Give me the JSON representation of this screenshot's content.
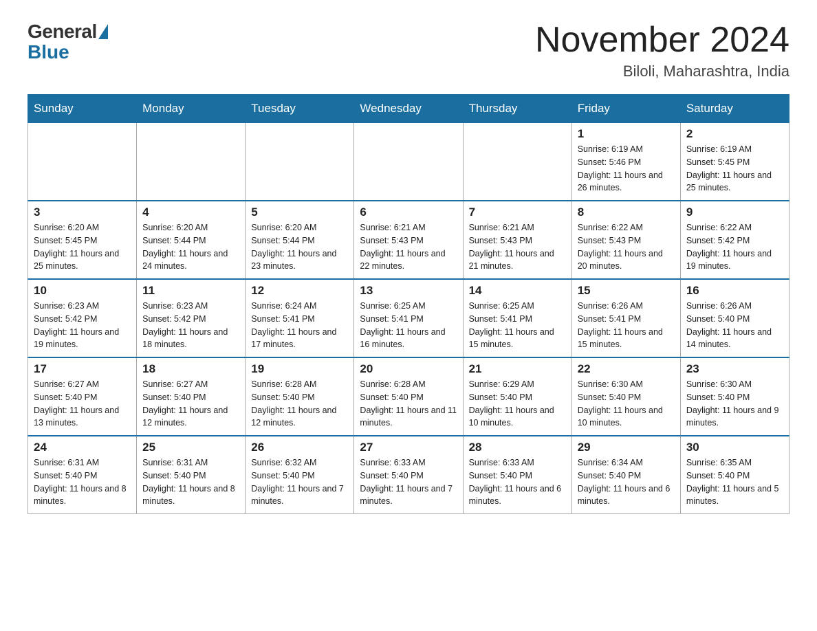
{
  "logo": {
    "general": "General",
    "blue": "Blue"
  },
  "title": "November 2024",
  "location": "Biloli, Maharashtra, India",
  "days_of_week": [
    "Sunday",
    "Monday",
    "Tuesday",
    "Wednesday",
    "Thursday",
    "Friday",
    "Saturday"
  ],
  "weeks": [
    [
      {
        "day": "",
        "info": ""
      },
      {
        "day": "",
        "info": ""
      },
      {
        "day": "",
        "info": ""
      },
      {
        "day": "",
        "info": ""
      },
      {
        "day": "",
        "info": ""
      },
      {
        "day": "1",
        "info": "Sunrise: 6:19 AM\nSunset: 5:46 PM\nDaylight: 11 hours and 26 minutes."
      },
      {
        "day": "2",
        "info": "Sunrise: 6:19 AM\nSunset: 5:45 PM\nDaylight: 11 hours and 25 minutes."
      }
    ],
    [
      {
        "day": "3",
        "info": "Sunrise: 6:20 AM\nSunset: 5:45 PM\nDaylight: 11 hours and 25 minutes."
      },
      {
        "day": "4",
        "info": "Sunrise: 6:20 AM\nSunset: 5:44 PM\nDaylight: 11 hours and 24 minutes."
      },
      {
        "day": "5",
        "info": "Sunrise: 6:20 AM\nSunset: 5:44 PM\nDaylight: 11 hours and 23 minutes."
      },
      {
        "day": "6",
        "info": "Sunrise: 6:21 AM\nSunset: 5:43 PM\nDaylight: 11 hours and 22 minutes."
      },
      {
        "day": "7",
        "info": "Sunrise: 6:21 AM\nSunset: 5:43 PM\nDaylight: 11 hours and 21 minutes."
      },
      {
        "day": "8",
        "info": "Sunrise: 6:22 AM\nSunset: 5:43 PM\nDaylight: 11 hours and 20 minutes."
      },
      {
        "day": "9",
        "info": "Sunrise: 6:22 AM\nSunset: 5:42 PM\nDaylight: 11 hours and 19 minutes."
      }
    ],
    [
      {
        "day": "10",
        "info": "Sunrise: 6:23 AM\nSunset: 5:42 PM\nDaylight: 11 hours and 19 minutes."
      },
      {
        "day": "11",
        "info": "Sunrise: 6:23 AM\nSunset: 5:42 PM\nDaylight: 11 hours and 18 minutes."
      },
      {
        "day": "12",
        "info": "Sunrise: 6:24 AM\nSunset: 5:41 PM\nDaylight: 11 hours and 17 minutes."
      },
      {
        "day": "13",
        "info": "Sunrise: 6:25 AM\nSunset: 5:41 PM\nDaylight: 11 hours and 16 minutes."
      },
      {
        "day": "14",
        "info": "Sunrise: 6:25 AM\nSunset: 5:41 PM\nDaylight: 11 hours and 15 minutes."
      },
      {
        "day": "15",
        "info": "Sunrise: 6:26 AM\nSunset: 5:41 PM\nDaylight: 11 hours and 15 minutes."
      },
      {
        "day": "16",
        "info": "Sunrise: 6:26 AM\nSunset: 5:40 PM\nDaylight: 11 hours and 14 minutes."
      }
    ],
    [
      {
        "day": "17",
        "info": "Sunrise: 6:27 AM\nSunset: 5:40 PM\nDaylight: 11 hours and 13 minutes."
      },
      {
        "day": "18",
        "info": "Sunrise: 6:27 AM\nSunset: 5:40 PM\nDaylight: 11 hours and 12 minutes."
      },
      {
        "day": "19",
        "info": "Sunrise: 6:28 AM\nSunset: 5:40 PM\nDaylight: 11 hours and 12 minutes."
      },
      {
        "day": "20",
        "info": "Sunrise: 6:28 AM\nSunset: 5:40 PM\nDaylight: 11 hours and 11 minutes."
      },
      {
        "day": "21",
        "info": "Sunrise: 6:29 AM\nSunset: 5:40 PM\nDaylight: 11 hours and 10 minutes."
      },
      {
        "day": "22",
        "info": "Sunrise: 6:30 AM\nSunset: 5:40 PM\nDaylight: 11 hours and 10 minutes."
      },
      {
        "day": "23",
        "info": "Sunrise: 6:30 AM\nSunset: 5:40 PM\nDaylight: 11 hours and 9 minutes."
      }
    ],
    [
      {
        "day": "24",
        "info": "Sunrise: 6:31 AM\nSunset: 5:40 PM\nDaylight: 11 hours and 8 minutes."
      },
      {
        "day": "25",
        "info": "Sunrise: 6:31 AM\nSunset: 5:40 PM\nDaylight: 11 hours and 8 minutes."
      },
      {
        "day": "26",
        "info": "Sunrise: 6:32 AM\nSunset: 5:40 PM\nDaylight: 11 hours and 7 minutes."
      },
      {
        "day": "27",
        "info": "Sunrise: 6:33 AM\nSunset: 5:40 PM\nDaylight: 11 hours and 7 minutes."
      },
      {
        "day": "28",
        "info": "Sunrise: 6:33 AM\nSunset: 5:40 PM\nDaylight: 11 hours and 6 minutes."
      },
      {
        "day": "29",
        "info": "Sunrise: 6:34 AM\nSunset: 5:40 PM\nDaylight: 11 hours and 6 minutes."
      },
      {
        "day": "30",
        "info": "Sunrise: 6:35 AM\nSunset: 5:40 PM\nDaylight: 11 hours and 5 minutes."
      }
    ]
  ]
}
